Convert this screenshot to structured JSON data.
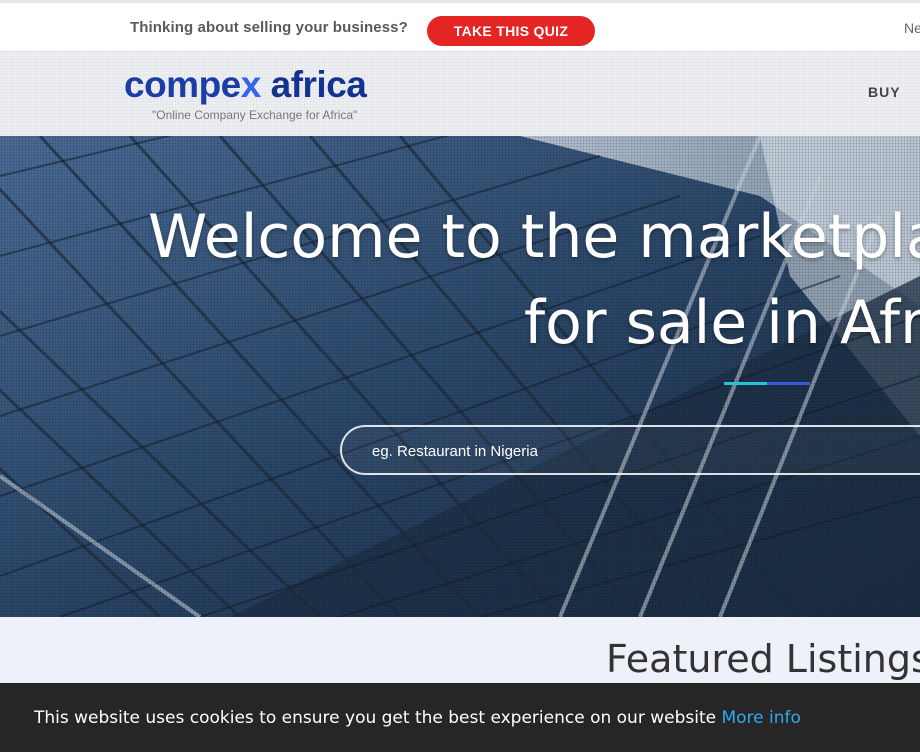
{
  "promo": {
    "text": "Thinking about selling your business?",
    "quiz_button": "TAKE THIS QUIZ",
    "right_text": "Ne"
  },
  "header": {
    "logo": {
      "compex_part1": "compe",
      "compex_x": "x",
      "africa": "africa",
      "tagline": "\"Online Company Exchange for Africa\""
    },
    "nav": {
      "buy": "BUY"
    }
  },
  "hero": {
    "title_line1": "Welcome to the marketplac",
    "title_line2": "for sale in Afri",
    "search_placeholder": "eg. Restaurant in Nigeria"
  },
  "featured": {
    "title": "Featured Listings"
  },
  "cookie": {
    "message": "This website uses cookies to ensure you get the best experience on our website",
    "link": "More info"
  },
  "colors": {
    "quiz_button": "#e52424",
    "logo_blue": "#1b3ea6",
    "logo_x": "#3465e8",
    "cookie_bg": "#262626",
    "cookie_link": "#31a8f0",
    "divider_cyan": "#28c3d4",
    "divider_blue": "#3b5bd6"
  }
}
